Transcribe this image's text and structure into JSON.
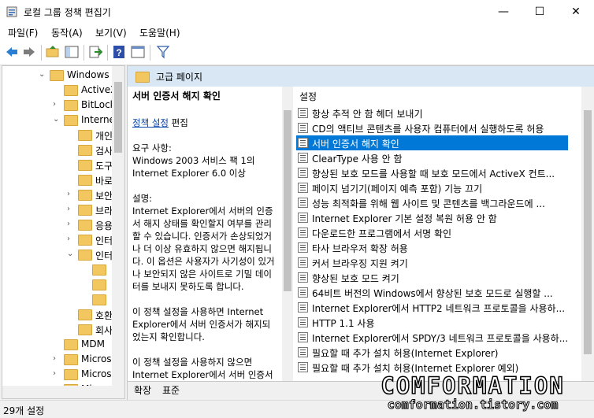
{
  "window": {
    "title": "로컬 그룹 정책 편집기",
    "minimize": "—",
    "maximize": "☐",
    "close": "✕"
  },
  "menu": [
    "파일(F)",
    "동작(A)",
    "보기(V)",
    "도움말(H)"
  ],
  "toolbar": [
    "back-icon",
    "forward-icon",
    "up-folder-icon",
    "show-hide-tree-icon",
    "export-icon",
    "help-icon",
    "properties-icon",
    "filter-icon"
  ],
  "tree": {
    "items": [
      {
        "label": "Windows",
        "indent": 0,
        "chev": "⌄"
      },
      {
        "label": "ActiveX",
        "indent": 1,
        "chev": ""
      },
      {
        "label": "BitLock",
        "indent": 1,
        "chev": "›"
      },
      {
        "label": "Interne",
        "indent": 1,
        "chev": "⌄"
      },
      {
        "label": "개인",
        "indent": 2,
        "chev": ""
      },
      {
        "label": "검사",
        "indent": 2,
        "chev": ""
      },
      {
        "label": "도구",
        "indent": 2,
        "chev": ""
      },
      {
        "label": "바로",
        "indent": 2,
        "chev": ""
      },
      {
        "label": "보안",
        "indent": 2,
        "chev": "›"
      },
      {
        "label": "브라",
        "indent": 2,
        "chev": "›"
      },
      {
        "label": "응용",
        "indent": 2,
        "chev": "›"
      },
      {
        "label": "인터",
        "indent": 2,
        "chev": "›"
      },
      {
        "label": "인터",
        "indent": 2,
        "chev": "⌄"
      },
      {
        "label": "",
        "indent": 3,
        "chev": ""
      },
      {
        "label": "",
        "indent": 3,
        "chev": ""
      },
      {
        "label": "",
        "indent": 3,
        "chev": ""
      },
      {
        "label": "호환",
        "indent": 2,
        "chev": ""
      },
      {
        "label": "회사",
        "indent": 2,
        "chev": ""
      },
      {
        "label": "MDM",
        "indent": 1,
        "chev": ""
      },
      {
        "label": "Micros",
        "indent": 1,
        "chev": "›"
      },
      {
        "label": "Micros",
        "indent": 1,
        "chev": "›"
      },
      {
        "label": "Micros",
        "indent": 1,
        "chev": "›"
      }
    ]
  },
  "right": {
    "header": "고급 페이지",
    "desc": {
      "title": "서버 인증서 해지 확인",
      "link": "정책 설정",
      "link_suffix": " 편집",
      "req_label": "요구 사항:",
      "req_text": "Windows 2003 서비스 팩 1의 Internet Explorer 6.0 이상",
      "desc_label": "설명:",
      "desc_text": "Internet Explorer에서 서버의 인증서 해지 상태를 확인할지 여부를 관리할 수 있습니다. 인증서가 손상되었거나 더 이상 유효하지 않으면 해지됩니다. 이 옵션은 사용자가 사기성이 있거나 보안되지 않은 사이트로 기밀 데이터를 보내지 못하도록 합니다.",
      "para2": "이 정책 설정을 사용하면 Internet Explorer에서 서버 인증서가 해지되었는지 확인합니다.",
      "para3": "이 정책 설정을 사용하지 않으면 Internet Explorer에서 서버 인증서가 해지되었는지 확인하지 않습니다."
    },
    "list_header": "설정",
    "settings": [
      "항상 추적 안 함 헤더 보내기",
      "CD의 액티브 콘텐츠를 사용자 컴퓨터에서 실행하도록 허용",
      "서버 인증서 해지 확인",
      "ClearType 사용 안 함",
      "향상된 보호 모드를 사용할 때 보호 모드에서 ActiveX 컨트...",
      "페이지 넘기기(페이지 예측 포함) 기능 끄기",
      "성능 최적화를 위해 웹 사이트 및 콘텐츠를 백그라운드에 ...",
      "Internet Explorer 기본 설정 복원 허용 안 함",
      "다운로드한 프로그램에서 서명 확인",
      "타사 브라우저 확장 허용",
      "커서 브라우징 지원 켜기",
      "향상된 보호 모드 켜기",
      "64비트 버전의 Windows에서 향상된 보호 모드로 실행할 ...",
      "Internet Explorer에서 HTTP2 네트워크 프로토콜을 사용하...",
      "HTTP 1.1 사용",
      "Internet Explorer에서 SPDY/3 네트워크 프로토콜을 사용하...",
      "필요할 때 추가 설치 허용(Internet Explorer)",
      "필요할 때 추가 설치 허용(Internet Explorer 예외)"
    ],
    "selected_index": 2,
    "tabs": [
      "확장",
      "표준"
    ]
  },
  "status": "29개 설정",
  "watermark": {
    "big": "COMFORMATION",
    "small": "comformation.tistory.com"
  }
}
